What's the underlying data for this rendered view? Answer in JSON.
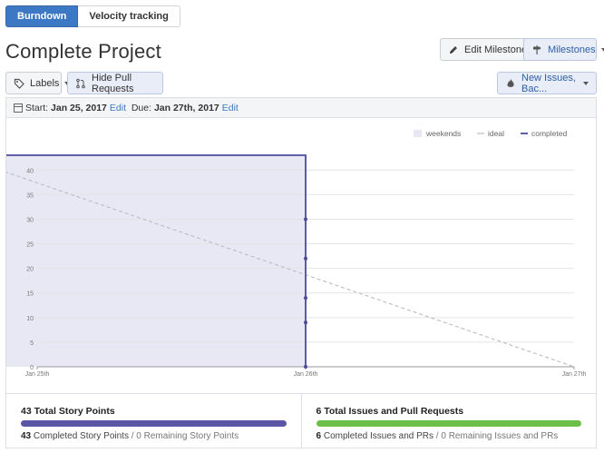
{
  "tabs": [
    {
      "label": "Burndown",
      "active": true
    },
    {
      "label": "Velocity tracking",
      "active": false
    }
  ],
  "page": {
    "title": "Complete Project"
  },
  "toolbar": {
    "edit_milestone": "Edit Milestone",
    "milestones": "Milestones",
    "labels": "Labels",
    "hide_prs": "Hide Pull Requests",
    "issues_filter": "New Issues, Bac..."
  },
  "dates": {
    "start_label": "Start:",
    "start_value": "Jan 25, 2017",
    "start_edit": "Edit",
    "due_label": "Due:",
    "due_value": "Jan 27th, 2017",
    "due_edit": "Edit"
  },
  "chart_data": {
    "type": "line",
    "legend": [
      "weekends",
      "ideal",
      "completed"
    ],
    "legend_position": "top-right",
    "x_ticks": [
      "Jan 25th",
      "Jan 26th",
      "Jan 27th"
    ],
    "y_ticks": [
      0,
      5,
      10,
      15,
      20,
      25,
      30,
      35,
      40
    ],
    "ylim": [
      0,
      43
    ],
    "xlim_days": [
      0,
      2
    ],
    "weekends": {
      "x0": -0.3,
      "x1": 1.0
    },
    "series": [
      {
        "name": "ideal",
        "x": [
          -0.3,
          2.0
        ],
        "y": [
          43,
          0
        ],
        "color": "#bbbbc4"
      },
      {
        "name": "completed",
        "x": [
          -0.3,
          1.0,
          1.0,
          1.0,
          1.0,
          1.0,
          1.0,
          1.0
        ],
        "y": [
          43,
          43,
          30,
          22,
          14,
          9,
          0,
          0
        ],
        "points": [
          30,
          22,
          14,
          9,
          0
        ],
        "color": "#4b4ba0"
      }
    ],
    "colors": {
      "weekends_fill": "#e8e8f4",
      "grid": "#e4e4e4"
    }
  },
  "summary": {
    "left": {
      "title": "43 Total Story Points",
      "completed_num": "43",
      "completed_text": " Completed Story Points",
      "remaining_text": " / 0 Remaining Story Points",
      "bar_color": "#5b57a6",
      "progress": 1.0
    },
    "right": {
      "title": "6 Total Issues and Pull Requests",
      "completed_num": "6",
      "completed_text": " Completed Issues and PRs",
      "remaining_text": " / 0 Remaining Issues and PRs",
      "bar_color": "#6cc04a",
      "progress": 1.0
    }
  }
}
